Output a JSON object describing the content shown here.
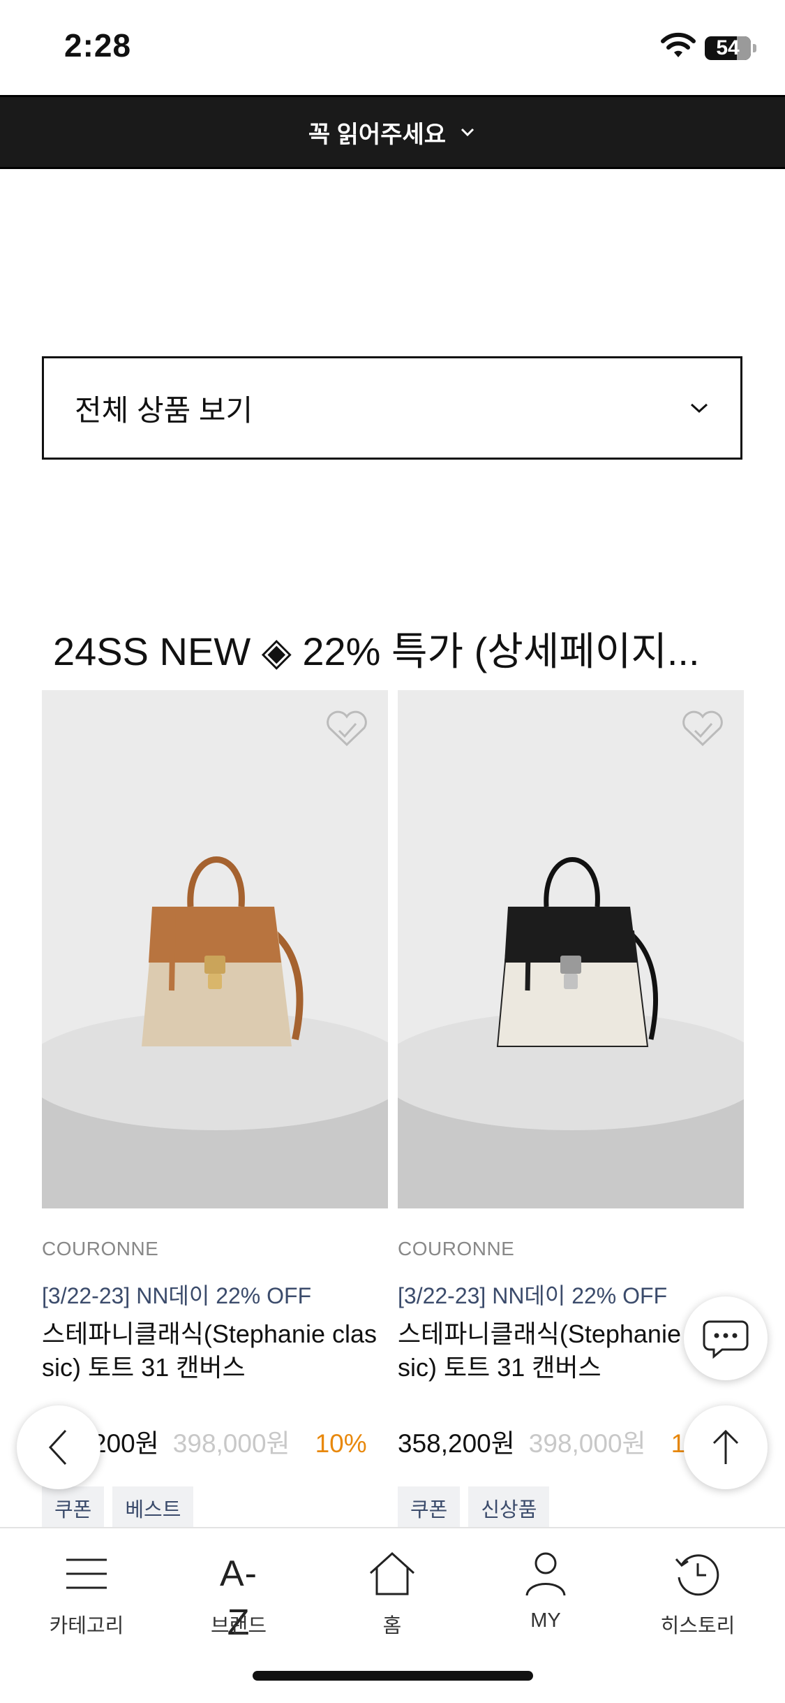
{
  "status_bar": {
    "time": "2:28",
    "battery": "54"
  },
  "notice": {
    "label": "꼭 읽어주세요"
  },
  "filter": {
    "label": "전체 상품 보기"
  },
  "section": {
    "title": "24SS NEW ◈ 22% 특가 (상세페이지..."
  },
  "products": [
    {
      "brand": "COURONNE",
      "promo": "[3/22-23] NN데이 22% OFF",
      "name": "스테파니클래식(Stephanie classic) 토트 31 캔버스",
      "price": "358,200원",
      "original_price": "398,000원",
      "discount": "10%",
      "tags": [
        "쿠폰",
        "베스트"
      ],
      "bag_colors": {
        "flap": "#b8743f",
        "body": "#dccbb0"
      }
    },
    {
      "brand": "COURONNE",
      "promo": "[3/22-23] NN데이 22% OFF",
      "name": "스테파니클래식(Stephanie classic) 토트 31 캔버스",
      "price": "358,200원",
      "original_price": "398,000원",
      "discount": "10%",
      "tags": [
        "쿠폰",
        "신상품"
      ],
      "bag_colors": {
        "flap": "#1c1c1c",
        "body": "#ece8df"
      }
    }
  ],
  "bottom_nav": [
    {
      "label": "카테고리",
      "icon": "menu-icon"
    },
    {
      "label": "브랜드",
      "icon": "az-icon",
      "icon_text": "A-Z"
    },
    {
      "label": "홈",
      "icon": "home-icon"
    },
    {
      "label": "MY",
      "icon": "person-icon"
    },
    {
      "label": "히스토리",
      "icon": "history-icon"
    }
  ],
  "colors": {
    "promo": "#3b4b6b",
    "discount": "#e8880c",
    "notice_bg": "#1a1a1a"
  }
}
